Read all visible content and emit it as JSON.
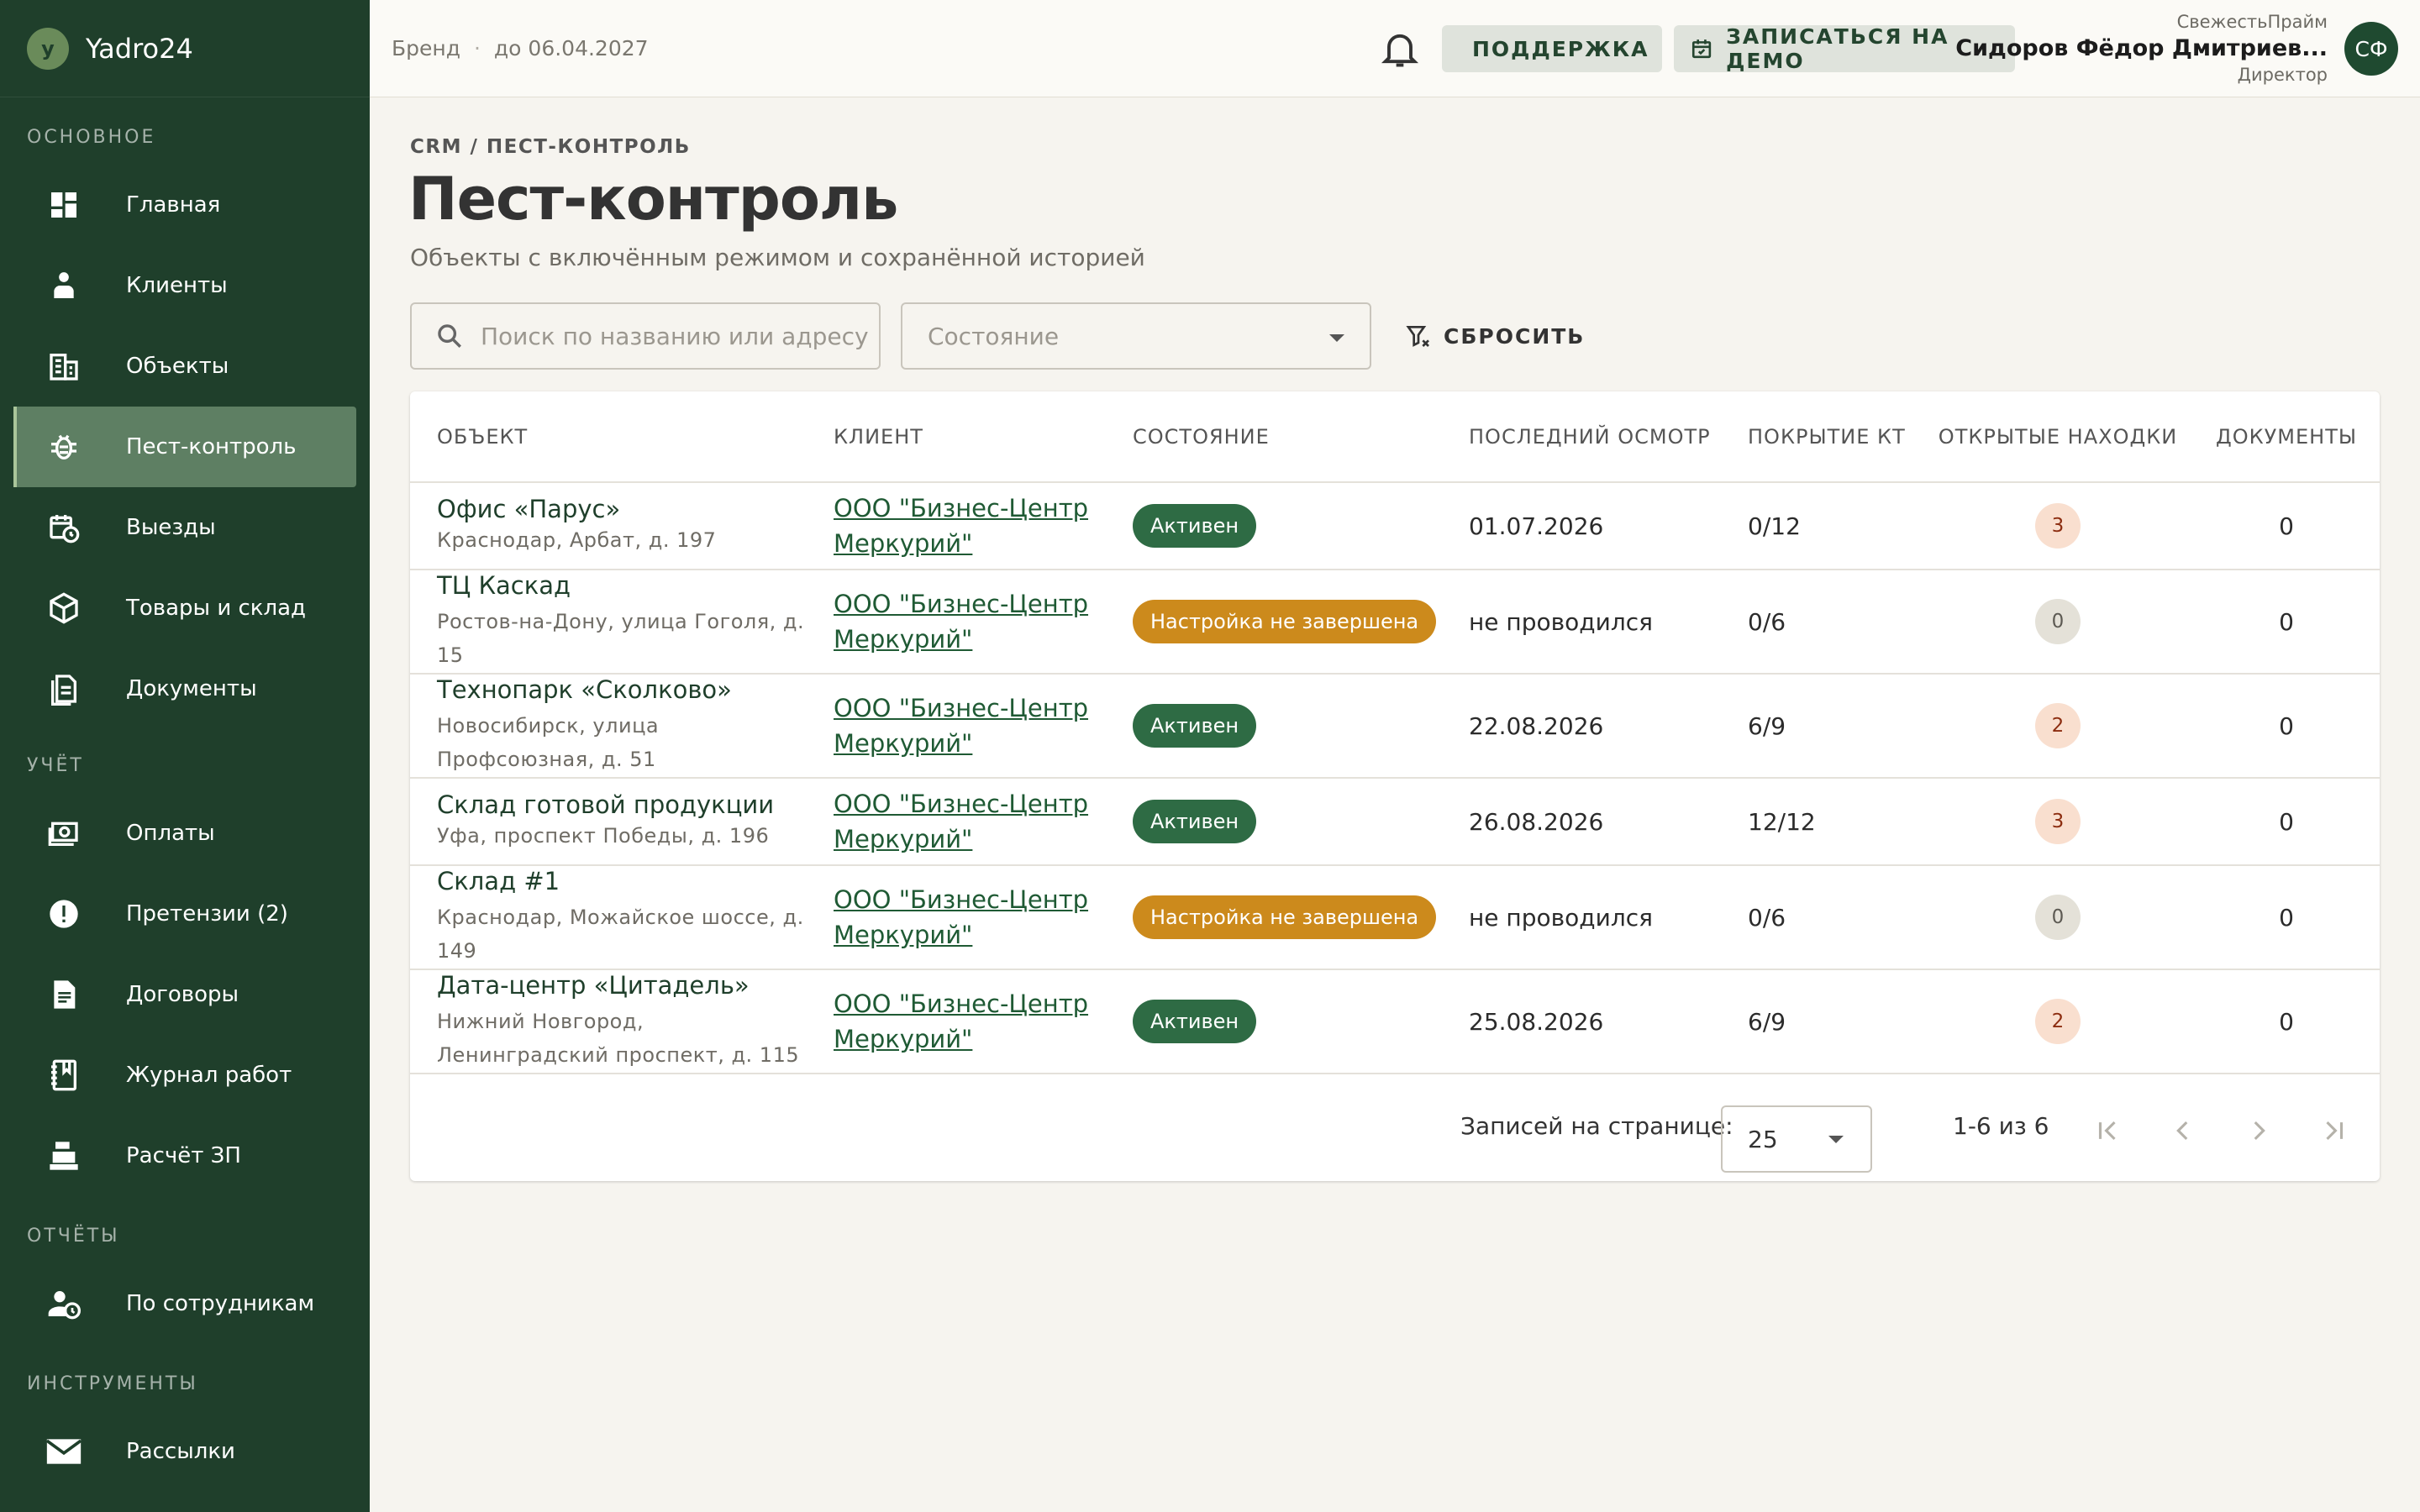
{
  "sidebar": {
    "logo_letter": "y",
    "app_name": "Yadro24",
    "sections": {
      "main": "ОСНОВНОЕ",
      "accounting": "УЧЁТ",
      "reports": "ОТЧЁТЫ",
      "tools": "ИНСТРУМЕНТЫ"
    },
    "items": {
      "home": "Главная",
      "clients": "Клиенты",
      "objects": "Объекты",
      "pest": "Пест-контроль",
      "visits": "Выезды",
      "goods": "Товары и склад",
      "docs": "Документы",
      "payments": "Оплаты",
      "claims": "Претензии (2)",
      "contracts": "Договоры",
      "journal": "Журнал работ",
      "salary": "Расчёт ЗП",
      "by_staff": "По сотрудникам",
      "mailing": "Рассылки"
    }
  },
  "topbar": {
    "plan": "Бренд",
    "plan_sep": "·",
    "plan_until": "до 06.04.2027",
    "support_label": "ПОДДЕРЖКА",
    "demo_label": "ЗАПИСАТЬСЯ НА ДЕМО",
    "user_org": "СвежестьПрайм",
    "user_name": "Сидоров Фёдор Дмитриев...",
    "user_role": "Директор",
    "user_initials": "СФ"
  },
  "page": {
    "breadcrumb": "CRM / ПЕСТ-КОНТРОЛЬ",
    "title": "Пест-контроль",
    "subtitle": "Объекты с включённым режимом и сохранённой историей"
  },
  "filters": {
    "search_placeholder": "Поиск по названию или адресу",
    "state_placeholder": "Состояние",
    "reset_label": "СБРОСИТЬ"
  },
  "table": {
    "headers": {
      "object": "ОБЪЕКТ",
      "client": "КЛИЕНТ",
      "state": "СОСТОЯНИЕ",
      "last_check": "ПОСЛЕДНИЙ ОСМОТР",
      "coverage": "ПОКРЫТИЕ КТ",
      "findings": "ОТКРЫТЫЕ НАХОДКИ",
      "docs": "ДОКУМЕНТЫ"
    },
    "rows": [
      {
        "name": "Офис «Парус»",
        "address": "Краснодар, Арбат, д. 197",
        "client_line1": "ООО \"Бизнес-Центр",
        "client_line2": "Меркурий\"",
        "state": "Активен",
        "last_check": "01.07.2026",
        "coverage": "0/12",
        "findings": "3",
        "docs": "0"
      },
      {
        "name": "ТЦ Каскад",
        "address": "Ростов-на-Дону, улица Гоголя, д. 15",
        "client_line1": "ООО \"Бизнес-Центр",
        "client_line2": "Меркурий\"",
        "state": "Настройка не завершена",
        "last_check": "не проводился",
        "coverage": "0/6",
        "findings": "0",
        "docs": "0"
      },
      {
        "name": "Технопарк «Сколково»",
        "address": "Новосибирск, улица Профсоюзная, д. 51",
        "client_line1": "ООО \"Бизнес-Центр",
        "client_line2": "Меркурий\"",
        "state": "Активен",
        "last_check": "22.08.2026",
        "coverage": "6/9",
        "findings": "2",
        "docs": "0"
      },
      {
        "name": "Склад готовой продукции",
        "address": "Уфа, проспект Победы, д. 196",
        "client_line1": "ООО \"Бизнес-Центр",
        "client_line2": "Меркурий\"",
        "state": "Активен",
        "last_check": "26.08.2026",
        "coverage": "12/12",
        "findings": "3",
        "docs": "0"
      },
      {
        "name": "Склад #1",
        "address": "Краснодар, Можайское шоссе, д. 149",
        "client_line1": "ООО \"Бизнес-Центр",
        "client_line2": "Меркурий\"",
        "state": "Настройка не завершена",
        "last_check": "не проводился",
        "coverage": "0/6",
        "findings": "0",
        "docs": "0"
      },
      {
        "name": "Дата-центр «Цитадель»",
        "address": "Нижний Новгород, Ленинградский проспект, д. 115",
        "client_line1": "ООО \"Бизнес-Центр",
        "client_line2": "Меркурий\"",
        "state": "Активен",
        "last_check": "25.08.2026",
        "coverage": "6/9",
        "findings": "2",
        "docs": "0"
      }
    ]
  },
  "pagination": {
    "per_page_label": "Записей на странице:",
    "per_page_value": "25",
    "range": "1-6 из 6"
  },
  "colors": {
    "sidebar_bg": "#1f3f2b",
    "active_nav": "#5e7f63",
    "badge_active": "#2e6b44",
    "badge_setup": "#cc8a1c",
    "finding_warn_bg": "#f9dfcf"
  }
}
